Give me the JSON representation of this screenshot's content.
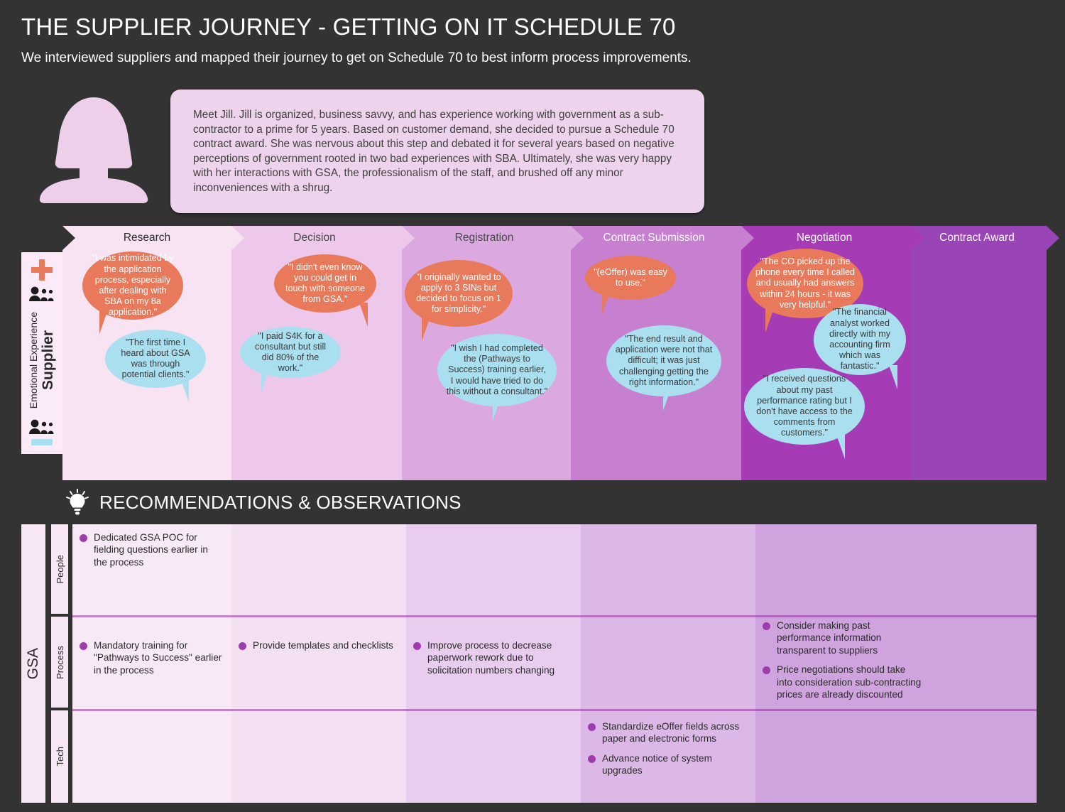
{
  "header": {
    "title": "THE SUPPLIER JOURNEY - GETTING ON IT SCHEDULE 70",
    "subtitle": "We interviewed suppliers and mapped their journey to get on Schedule 70 to best inform process improvements."
  },
  "persona": {
    "avatar_icon": "female-persona-icon",
    "text": "Meet Jill. Jill is organized, business savvy, and has experience working with government as a sub-contractor to a prime for 5 years. Based on customer demand, she decided to pursue a Schedule 70 contract award. She was nervous about this step and debated it for several years based on negative perceptions of government rooted in two bad experiences with SBA. Ultimately, she was very happy with her interactions with GSA, the professionalism of the staff, and brushed off any minor inconveniences with a shrug."
  },
  "journey": {
    "sidebar": {
      "plus_icon": "plus-icon",
      "minus_icon": "minus-icon",
      "people_icon": "people-icon",
      "actor_label": "Supplier",
      "measure_label": "Emotional Experience"
    },
    "stages": [
      {
        "label": "Research",
        "bg": "#f7e3f2",
        "text_color": "#2b2b2b"
      },
      {
        "label": "Decision",
        "bg": "#eec8ea",
        "text_color": "#4a4a4a"
      },
      {
        "label": "Registration",
        "bg": "#dba8df",
        "text_color": "#4a4a4a"
      },
      {
        "label": "Contract Submission",
        "bg": "#c77fd0",
        "text_color": "#ffffff"
      },
      {
        "label": "Negotiation",
        "bg": "#a63cb5",
        "text_color": "#ffffff"
      },
      {
        "label": "Contract Award",
        "bg": "#9a45b5",
        "text_color": "#ffffff"
      }
    ],
    "quotes": [
      {
        "stage": "Research",
        "sentiment": "negative",
        "text": "\"I was intimidated by the application process, especially after dealing with SBA on my 8a application.\""
      },
      {
        "stage": "Research",
        "sentiment": "positive",
        "text": "\"The first time I heard about GSA was through potential clients.\""
      },
      {
        "stage": "Decision",
        "sentiment": "negative",
        "text": "\"I didn't even know you could get in touch with someone from GSA.\""
      },
      {
        "stage": "Decision",
        "sentiment": "positive",
        "text": "\"I paid S4K for a consultant but still did 80% of the work.\""
      },
      {
        "stage": "Registration",
        "sentiment": "negative",
        "text": "\"I originally wanted to apply to 3 SINs but decided to focus on 1 for simplicity.\""
      },
      {
        "stage": "Registration",
        "sentiment": "positive",
        "text": "\"I wish I had completed the (Pathways to Success) training earlier, I would have tried to do this without a consultant.\""
      },
      {
        "stage": "Contract Submission",
        "sentiment": "negative",
        "text": "\"(eOffer) was easy to use.\""
      },
      {
        "stage": "Contract Submission",
        "sentiment": "positive",
        "text": "\"The end result and application were not that difficult; it was just challenging getting the right information.\""
      },
      {
        "stage": "Negotiation",
        "sentiment": "negative",
        "text": "\"The CO picked up the phone every time I called and usually had answers within 24 hours - it was very helpful.\""
      },
      {
        "stage": "Negotiation",
        "sentiment": "positive",
        "text": "\"The financial analyst worked directly with my accounting firm which was fantastic.\""
      },
      {
        "stage": "Negotiation",
        "sentiment": "positive",
        "text": "\"I received questions about my past performance rating but I don't have access to the comments from customers.\""
      }
    ]
  },
  "recommendations": {
    "section_title": "RECOMMENDATIONS & OBSERVATIONS",
    "bulb_icon": "lightbulb-icon",
    "group_label": "GSA",
    "categories": [
      "People",
      "Process",
      "Tech"
    ],
    "columns": [
      "Research",
      "Decision",
      "Registration",
      "Contract Submission",
      "Negotiation",
      "Contract Award"
    ],
    "cells": {
      "people": {
        "research": [
          "Dedicated GSA POC for fielding questions earlier in the process"
        ],
        "decision": [],
        "registration": [],
        "contract_submission": [],
        "negotiation": [],
        "contract_award": []
      },
      "process": {
        "research": [
          "Mandatory training for \"Pathways to Success\" earlier in the process"
        ],
        "decision": [
          "Provide templates and checklists"
        ],
        "registration": [
          "Improve process to decrease paperwork rework due to solicitation numbers changing"
        ],
        "contract_submission": [],
        "negotiation": [
          "Consider making past performance information transparent to suppliers",
          "Price negotiations should take into consideration sub-contracting prices are already discounted"
        ],
        "contract_award": []
      },
      "tech": {
        "research": [],
        "decision": [],
        "registration": [],
        "contract_submission": [
          "Standardize eOffer fields across paper and electronic forms",
          "Advance notice of system upgrades"
        ],
        "negotiation": [],
        "contract_award": []
      }
    }
  },
  "colors": {
    "page_bg": "#333333",
    "negative_bubble": "#e8795a",
    "positive_bubble": "#aadff0",
    "accent_purple": "#9c3dab",
    "persona_box": "#eed3ec"
  }
}
